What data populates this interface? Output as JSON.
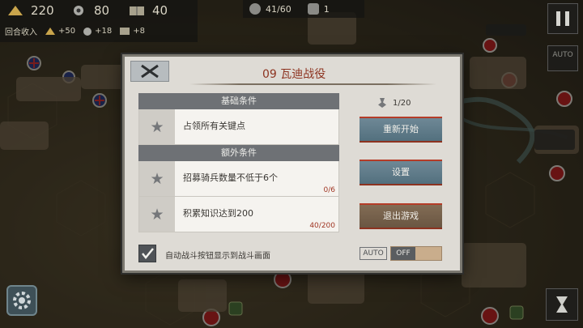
{
  "resources": {
    "gold": "220",
    "industry": "80",
    "tech": "40"
  },
  "income": {
    "label": "回合收入",
    "gold": "+50",
    "industry": "+18",
    "tech": "+8"
  },
  "top_status": {
    "units": "41/60",
    "count": "1"
  },
  "auto_button": "AUTO",
  "dialog": {
    "title": "09 瓦迪战役",
    "basic_header": "基础条件",
    "basic_conditions": [
      {
        "text": "占领所有关键点",
        "progress": ""
      }
    ],
    "extra_header": "额外条件",
    "extra_conditions": [
      {
        "text": "招募骑兵数量不低于6个",
        "progress": "0/6"
      },
      {
        "text": "积累知识达到200",
        "progress": "40/200"
      }
    ],
    "medal_count": "1/20",
    "buttons": {
      "restart": "重新开始",
      "settings": "设置",
      "quit": "退出游戏"
    },
    "checkbox_label": "自动战斗按钮显示到战斗画面",
    "auto_tag": "AUTO",
    "toggle_state": "OFF"
  }
}
